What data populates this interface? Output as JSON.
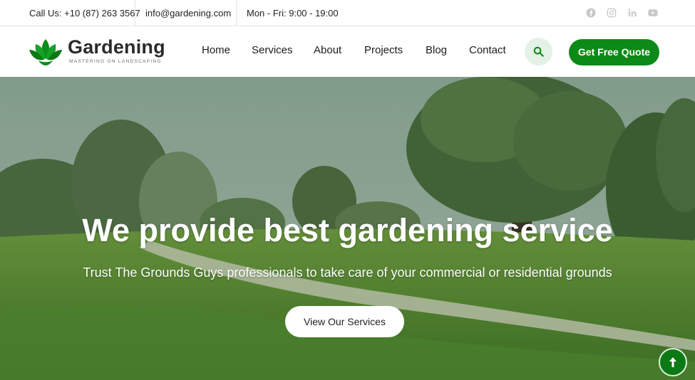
{
  "topbar": {
    "phone": "Call Us: +10 (87) 263 3567",
    "email": "info@gardening.com",
    "hours": "Mon - Fri: 9:00 - 19:00",
    "social_icons": [
      "facebook-icon",
      "instagram-icon",
      "linkedin-icon",
      "youtube-icon"
    ]
  },
  "brand": {
    "name": "Gardening",
    "tagline": "MASTERING ON LANDSCAPING",
    "color": "#0c8a17"
  },
  "nav": {
    "items": [
      "Home",
      "Services",
      "About",
      "Projects",
      "Blog",
      "Contact"
    ],
    "search_icon": "search-icon",
    "cta_label": "Get Free Quote"
  },
  "hero": {
    "title": "We provide best gardening service",
    "subtitle": "Trust The Grounds Guys professionals to take care of your commercial or residential grounds",
    "button_label": "View Our Services"
  },
  "scroll_top_icon": "arrow-up-icon"
}
